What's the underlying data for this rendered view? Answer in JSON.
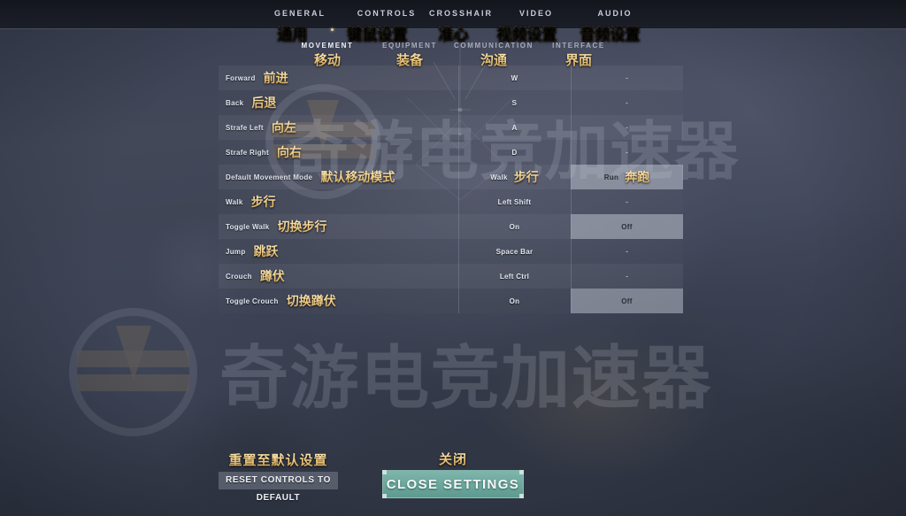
{
  "header": {
    "tabs": [
      {
        "en": "GENERAL",
        "cn": "通用",
        "active": false
      },
      {
        "en": "CONTROLS",
        "cn": "键鼠设置",
        "active": true
      },
      {
        "en": "CROSSHAIR",
        "cn": "准心",
        "active": false
      },
      {
        "en": "VIDEO",
        "cn": "视频设置",
        "active": false
      },
      {
        "en": "AUDIO",
        "cn": "音频设置",
        "active": false
      }
    ],
    "subtabs": [
      {
        "en": "MOVEMENT",
        "cn": "移动",
        "active": true
      },
      {
        "en": "EQUIPMENT",
        "cn": "装备",
        "active": false
      },
      {
        "en": "COMMUNICATION",
        "cn": "沟通",
        "active": false
      },
      {
        "en": "INTERFACE",
        "cn": "界面",
        "active": false
      }
    ]
  },
  "table": {
    "rows": [
      {
        "name_en": "Forward",
        "name_cn": "前进",
        "primary_en": "W",
        "primary_cn": "",
        "primary_hl": false,
        "secondary_en": "-",
        "secondary_cn": "",
        "secondary_hl": false
      },
      {
        "name_en": "Back",
        "name_cn": "后退",
        "primary_en": "S",
        "primary_cn": "",
        "primary_hl": false,
        "secondary_en": "-",
        "secondary_cn": "",
        "secondary_hl": false
      },
      {
        "name_en": "Strafe Left",
        "name_cn": "向左",
        "primary_en": "A",
        "primary_cn": "",
        "primary_hl": false,
        "secondary_en": "-",
        "secondary_cn": "",
        "secondary_hl": false
      },
      {
        "name_en": "Strafe Right",
        "name_cn": "向右",
        "primary_en": "D",
        "primary_cn": "",
        "primary_hl": false,
        "secondary_en": "-",
        "secondary_cn": "",
        "secondary_hl": false
      },
      {
        "name_en": "Default Movement Mode",
        "name_cn": "默认移动模式",
        "primary_en": "Walk",
        "primary_cn": "步行",
        "primary_hl": false,
        "secondary_en": "Run",
        "secondary_cn": "奔跑",
        "secondary_hl": true
      },
      {
        "name_en": "Walk",
        "name_cn": "步行",
        "primary_en": "Left Shift",
        "primary_cn": "",
        "primary_hl": false,
        "secondary_en": "-",
        "secondary_cn": "",
        "secondary_hl": false
      },
      {
        "name_en": "Toggle Walk",
        "name_cn": "切换步行",
        "primary_en": "On",
        "primary_cn": "",
        "primary_hl": false,
        "secondary_en": "Off",
        "secondary_cn": "",
        "secondary_hl": true
      },
      {
        "name_en": "Jump",
        "name_cn": "跳跃",
        "primary_en": "Space Bar",
        "primary_cn": "",
        "primary_hl": false,
        "secondary_en": "-",
        "secondary_cn": "",
        "secondary_hl": false
      },
      {
        "name_en": "Crouch",
        "name_cn": "蹲伏",
        "primary_en": "Left Ctrl",
        "primary_cn": "",
        "primary_hl": false,
        "secondary_en": "-",
        "secondary_cn": "",
        "secondary_hl": false
      },
      {
        "name_en": "Toggle Crouch",
        "name_cn": "切换蹲伏",
        "primary_en": "On",
        "primary_cn": "",
        "primary_hl": false,
        "secondary_en": "Off",
        "secondary_cn": "",
        "secondary_hl": true
      }
    ]
  },
  "footer": {
    "reset_cn": "重置至默认设置",
    "reset_en": "RESET CONTROLS TO DEFAULT",
    "close_cn": "关闭",
    "close_en": "CLOSE SETTINGS"
  },
  "watermark": {
    "text_top": "奇游电竞加速器",
    "text_bottom": "奇游电竞加速器"
  },
  "colors": {
    "gold": "#f2ce85",
    "teal": "#6ba79c",
    "header_bar": "#181b23",
    "row_highlight": "#bec4d0"
  }
}
